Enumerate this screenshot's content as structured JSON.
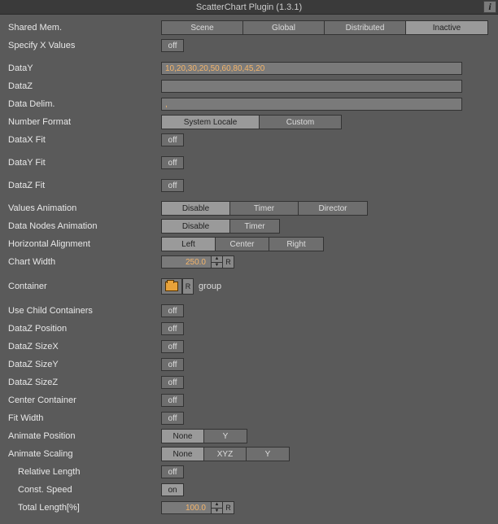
{
  "title": "ScatterChart Plugin (1.3.1)",
  "info_icon": "i",
  "reset_label": "R",
  "shared_mem": {
    "label": "Shared Mem.",
    "options": [
      "Scene",
      "Global",
      "Distributed",
      "Inactive"
    ],
    "active": "Inactive"
  },
  "specify_x": {
    "label": "Specify X Values",
    "state": "off"
  },
  "data_y": {
    "label": "DataY",
    "value": "10,20,30,20,50,60,80,45,20"
  },
  "data_z": {
    "label": "DataZ",
    "value": ""
  },
  "data_delim": {
    "label": "Data Delim.",
    "value": ","
  },
  "num_format": {
    "label": "Number Format",
    "options": [
      "System Locale",
      "Custom"
    ],
    "active": "System Locale"
  },
  "datax_fit": {
    "label": "DataX Fit",
    "state": "off"
  },
  "datay_fit": {
    "label": "DataY Fit",
    "state": "off"
  },
  "dataz_fit": {
    "label": "DataZ Fit",
    "state": "off"
  },
  "values_anim": {
    "label": "Values Animation",
    "options": [
      "Disable",
      "Timer",
      "Director"
    ],
    "active": "Disable"
  },
  "nodes_anim": {
    "label": "Data Nodes Animation",
    "options": [
      "Disable",
      "Timer"
    ],
    "active": "Disable"
  },
  "halign": {
    "label": "Horizontal Alignment",
    "options": [
      "Left",
      "Center",
      "Right"
    ],
    "active": "Left"
  },
  "chart_width": {
    "label": "Chart Width",
    "value": "250.0"
  },
  "container": {
    "label": "Container",
    "name": "group"
  },
  "use_child": {
    "label": "Use Child Containers",
    "state": "off"
  },
  "dz_pos": {
    "label": "DataZ Position",
    "state": "off"
  },
  "dz_sx": {
    "label": "DataZ SizeX",
    "state": "off"
  },
  "dz_sy": {
    "label": "DataZ SizeY",
    "state": "off"
  },
  "dz_sz": {
    "label": "DataZ SizeZ",
    "state": "off"
  },
  "center_c": {
    "label": "Center Container",
    "state": "off"
  },
  "fit_w": {
    "label": "Fit Width",
    "state": "off"
  },
  "anim_pos": {
    "label": "Animate Position",
    "options": [
      "None",
      "Y"
    ],
    "active": "None"
  },
  "anim_scale": {
    "label": "Animate Scaling",
    "options": [
      "None",
      "XYZ",
      "Y"
    ],
    "active": "None"
  },
  "rel_len": {
    "label": "Relative Length",
    "state": "off"
  },
  "const_sp": {
    "label": "Const. Speed",
    "state": "on"
  },
  "total_len": {
    "label": "Total Length[%]",
    "value": "100.0"
  }
}
